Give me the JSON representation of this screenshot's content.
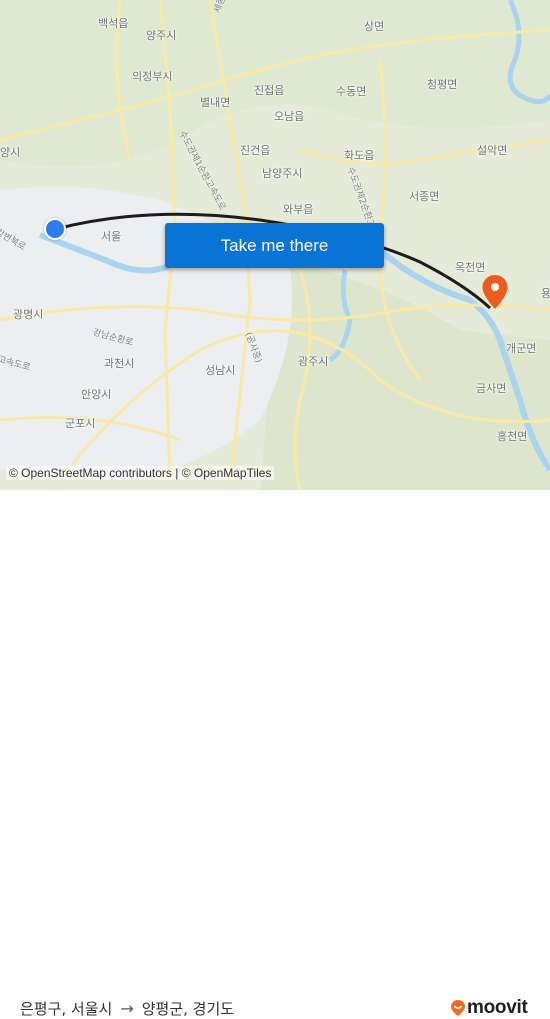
{
  "map": {
    "places": [
      {
        "id": "baekseok",
        "label": "백석읍"
      },
      {
        "id": "yangju",
        "label": "양주시"
      },
      {
        "id": "uijeongbu",
        "label": "의정부시"
      },
      {
        "id": "byeollae",
        "label": "별내면"
      },
      {
        "id": "jinjeop",
        "label": "진접읍"
      },
      {
        "id": "onam",
        "label": "오남읍"
      },
      {
        "id": "jingeon",
        "label": "진건읍"
      },
      {
        "id": "namyangju",
        "label": "남양주시"
      },
      {
        "id": "sangmyeon",
        "label": "상면"
      },
      {
        "id": "sudong",
        "label": "수동면"
      },
      {
        "id": "cheongpyeong",
        "label": "청평면"
      },
      {
        "id": "hwado",
        "label": "화도읍"
      },
      {
        "id": "seorak",
        "label": "설악면"
      },
      {
        "id": "seojong",
        "label": "서종면"
      },
      {
        "id": "wabu",
        "label": "와부읍"
      },
      {
        "id": "seoul",
        "label": "서울"
      },
      {
        "id": "goyang",
        "label": "양시"
      },
      {
        "id": "gwangmyeong",
        "label": "광명시"
      },
      {
        "id": "gwacheon",
        "label": "과천시"
      },
      {
        "id": "anyang",
        "label": "안양시"
      },
      {
        "id": "gunpo",
        "label": "군포시"
      },
      {
        "id": "seongnam",
        "label": "성남시"
      },
      {
        "id": "gwangju",
        "label": "광주시"
      },
      {
        "id": "okcheon",
        "label": "옥천면"
      },
      {
        "id": "gaegun",
        "label": "개군면"
      },
      {
        "id": "geumsa",
        "label": "금사면"
      },
      {
        "id": "heungcheon",
        "label": "흥천면"
      },
      {
        "id": "yong",
        "label": "용"
      }
    ],
    "road_labels": [
      {
        "id": "r1",
        "label": "수도권제1순환고속도로"
      },
      {
        "id": "r2",
        "label": "세종포천고속도로"
      },
      {
        "id": "r3",
        "label": "강남순환로"
      },
      {
        "id": "r4",
        "label": "(공사중)"
      },
      {
        "id": "r5",
        "label": "수도권제2순환고속도로"
      },
      {
        "id": "r6",
        "label": "강변북로"
      },
      {
        "id": "r7",
        "label": "고속도로"
      }
    ],
    "cta_label": "Take me there",
    "attribution": "© OpenStreetMap contributors | © OpenMapTiles",
    "origin_color": "#2d7df2",
    "destination_color": "#f15a1f"
  },
  "footer": {
    "origin": "은평구, 서울시",
    "arrow_icon": "arrow-right-icon",
    "destination": "양평군, 경기도",
    "brand": "moovit",
    "brand_color": "#f26b21"
  }
}
